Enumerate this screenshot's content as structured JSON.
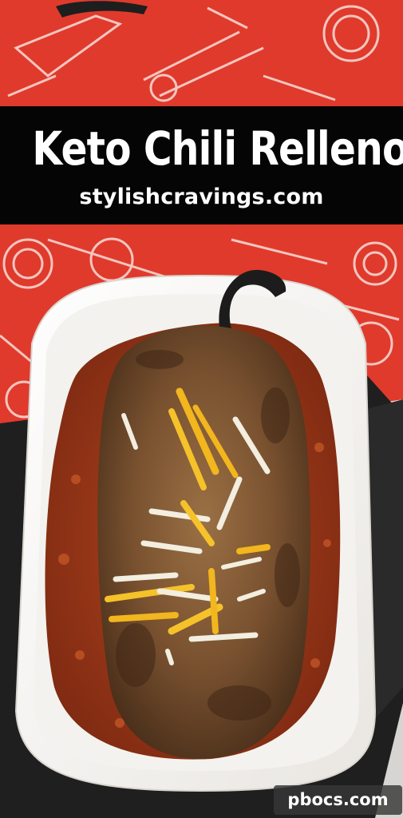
{
  "title": "Keto Chili Relleno",
  "site": "stylishcravings.com",
  "watermark": "pbocs.com",
  "colors": {
    "banner": "#050505",
    "napkin": "#e03a2c",
    "dish": "#f7f5f2",
    "tray": "#1f1f1f",
    "sauce": "#a03818",
    "pepper_crust": "#7a5230",
    "cheddar": "#f2b61e",
    "jack": "#f2eee0"
  }
}
